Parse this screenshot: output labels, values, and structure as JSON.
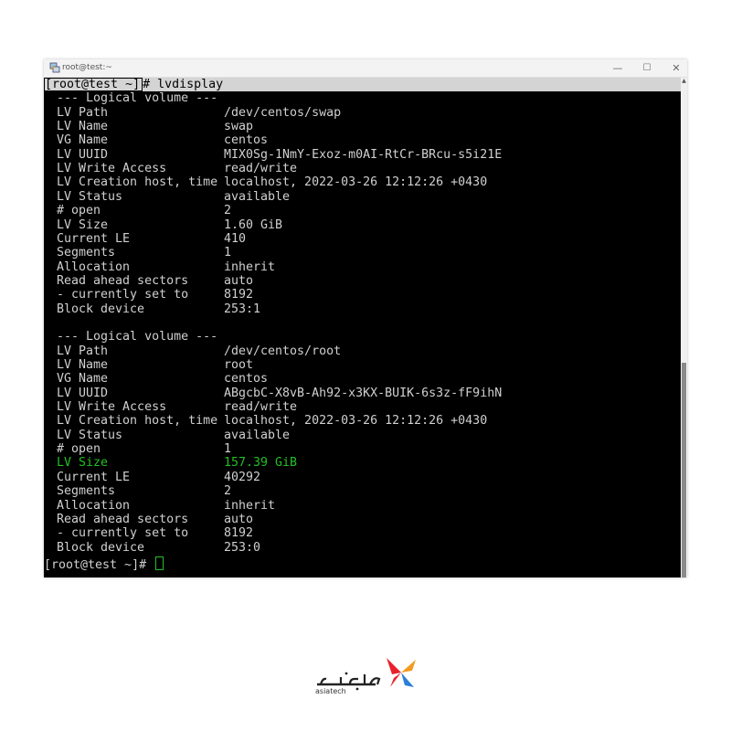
{
  "window": {
    "title": "root@test:~",
    "controls": {
      "minimize": "—",
      "maximize": "☐",
      "close": "✕"
    }
  },
  "terminal": {
    "command_prompt": "[root@test ~]",
    "command": "# lvdisplay",
    "volumes": [
      {
        "header": "--- Logical volume ---",
        "fields": [
          {
            "label": "LV Path",
            "value": "/dev/centos/swap"
          },
          {
            "label": "LV Name",
            "value": "swap"
          },
          {
            "label": "VG Name",
            "value": "centos"
          },
          {
            "label": "LV UUID",
            "value": "MIX0Sg-1NmY-Exoz-m0AI-RtCr-BRcu-s5i21E"
          },
          {
            "label": "LV Write Access",
            "value": "read/write"
          },
          {
            "label": "LV Creation host, time",
            "value": "localhost, 2022-03-26 12:12:26 +0430"
          },
          {
            "label": "LV Status",
            "value": "available"
          },
          {
            "label": "# open",
            "value": "2"
          },
          {
            "label": "LV Size",
            "value": "1.60 GiB"
          },
          {
            "label": "Current LE",
            "value": "410"
          },
          {
            "label": "Segments",
            "value": "1"
          },
          {
            "label": "Allocation",
            "value": "inherit"
          },
          {
            "label": "Read ahead sectors",
            "value": "auto"
          },
          {
            "label": "- currently set to",
            "value": "8192"
          },
          {
            "label": "Block device",
            "value": "253:1"
          }
        ]
      },
      {
        "header": "--- Logical volume ---",
        "fields": [
          {
            "label": "LV Path",
            "value": "/dev/centos/root"
          },
          {
            "label": "LV Name",
            "value": "root"
          },
          {
            "label": "VG Name",
            "value": "centos"
          },
          {
            "label": "LV UUID",
            "value": "ABgcbC-X8vB-Ah92-x3KX-BUIK-6s3z-fF9ihN"
          },
          {
            "label": "LV Write Access",
            "value": "read/write"
          },
          {
            "label": "LV Creation host, time",
            "value": "localhost, 2022-03-26 12:12:26 +0430"
          },
          {
            "label": "LV Status",
            "value": "available"
          },
          {
            "label": "# open",
            "value": "1"
          },
          {
            "label": "LV Size",
            "value": "157.39 GiB"
          },
          {
            "label": "Current LE",
            "value": "40292"
          },
          {
            "label": "Segments",
            "value": "2"
          },
          {
            "label": "Allocation",
            "value": "inherit"
          },
          {
            "label": "Read ahead sectors",
            "value": "auto"
          },
          {
            "label": "- currently set to",
            "value": "8192"
          },
          {
            "label": "Block device",
            "value": "253:0"
          }
        ]
      }
    ],
    "final_prompt": "[root@test ~]# ",
    "colors": {
      "background": "#000000",
      "text": "#d0d0d0",
      "highlight": "#22c022",
      "command_bar": "#d4d4d4"
    }
  },
  "logo": {
    "caption": "asiatech",
    "colors": {
      "red": "#e8212b",
      "blue": "#2b7fd8",
      "orange": "#f39a1e"
    }
  }
}
